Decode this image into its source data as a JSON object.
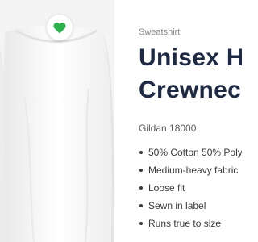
{
  "product": {
    "category": "Sweatshirt",
    "title_line1": "Unisex H",
    "title_line2": "Crewnec",
    "model": "Gildan 18000",
    "features": [
      "50% Cotton 50% Poly",
      "Medium-heavy fabric",
      "Loose fit",
      "Sewn in label",
      "Runs true to size"
    ]
  },
  "favorite": {
    "icon": "heart-icon",
    "active": true
  },
  "colors": {
    "heart": "#2bb24c",
    "title": "#1e2a44",
    "category": "#8a8a8a",
    "image_background": "#f4f4f4"
  }
}
